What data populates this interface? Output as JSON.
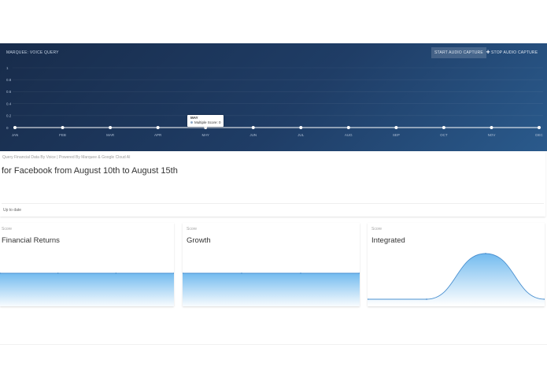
{
  "hero": {
    "title": "MARQUEE: VOICE QUERY",
    "start_label": "START AUDIO CAPTURE",
    "stop_label": "STOP AUDIO CAPTURE",
    "mic_icon": "microphone-icon",
    "y_ticks": [
      "1",
      "0.8",
      "0.6",
      "0.4",
      "0.2",
      "0"
    ],
    "months": [
      "JAN",
      "FEB",
      "MAR",
      "APR",
      "MAY",
      "JUN",
      "JUL",
      "AUG",
      "SEP",
      "OCT",
      "NOV",
      "DEC"
    ],
    "tooltip": {
      "month": "MAY",
      "line": "Multiple Score: 0"
    },
    "colors": {
      "bg_dark": "#182c4b",
      "bg_light": "#2a5a8c",
      "line": "#ffffff"
    }
  },
  "query": {
    "caption": "Query Financial Data By Voice | Powered By Marquee & Google Cloud AI",
    "text": "for Facebook from August 10th to August 15th",
    "status": "Up to date"
  },
  "cards": [
    {
      "caption": "Score",
      "title": "Financial Returns"
    },
    {
      "caption": "Score",
      "title": "Growth"
    },
    {
      "caption": "Score",
      "title": "Integrated"
    }
  ],
  "chart_data": [
    {
      "type": "line",
      "categories": [
        "JAN",
        "FEB",
        "MAR",
        "APR",
        "MAY",
        "JUN",
        "JUL",
        "AUG",
        "SEP",
        "OCT",
        "NOV",
        "DEC"
      ],
      "series": [
        {
          "values": [
            0,
            0,
            0,
            0,
            0,
            0,
            0,
            0,
            0,
            0,
            0,
            0
          ]
        }
      ],
      "ylim": [
        0,
        1
      ],
      "grid": true
    },
    {
      "type": "area",
      "x": [
        0,
        1,
        2,
        3
      ],
      "values": [
        0.5,
        0.5,
        0.5,
        0.5
      ],
      "ylim": [
        0,
        1
      ],
      "color": "#63b3ed"
    },
    {
      "type": "area",
      "x": [
        0,
        1,
        2,
        3
      ],
      "values": [
        0.5,
        0.5,
        0.5,
        0.5
      ],
      "ylim": [
        0,
        1
      ],
      "color": "#63b3ed"
    },
    {
      "type": "area",
      "x": [
        0,
        1,
        2,
        3
      ],
      "values": [
        0,
        0,
        1,
        0
      ],
      "ylim": [
        0,
        1
      ],
      "color": "#63b3ed"
    }
  ]
}
